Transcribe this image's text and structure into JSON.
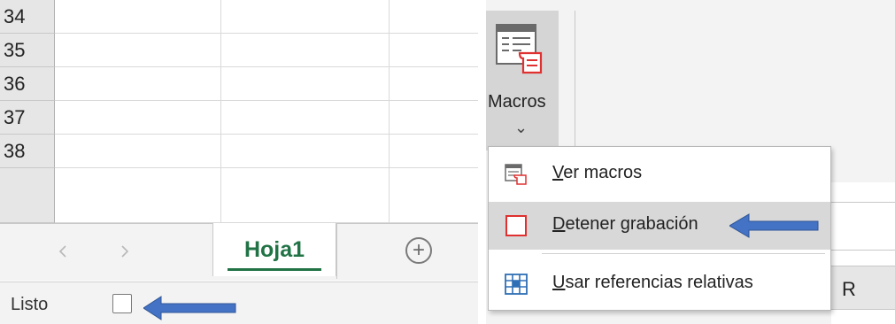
{
  "spreadsheet": {
    "row_numbers": [
      "34",
      "35",
      "36",
      "37",
      "38"
    ],
    "sheet_tab": "Hoja1",
    "add_sheet_symbol": "+",
    "nav_prev_symbol": "◀",
    "nav_next_symbol": "▶"
  },
  "statusbar": {
    "status_text": "Listo",
    "record_icon": "stop-recording-square-icon"
  },
  "ribbon": {
    "macros_label": "Macros",
    "macros_icon": "macros-icon",
    "chevron": "⌄",
    "column_header": "R"
  },
  "dropdown": {
    "items": [
      {
        "label": "Ver macros",
        "icon": "view-macros-icon",
        "mnemonic": "V",
        "rest": "er macros"
      },
      {
        "label": "Detener grabación",
        "icon": "stop-recording-icon",
        "mnemonic": "D",
        "rest": "etener grabación"
      },
      {
        "label": "Usar referencias relativas",
        "icon": "relative-references-icon",
        "mnemonic": "U",
        "rest": "sar referencias relativas"
      }
    ]
  },
  "colors": {
    "arrow": "#4472c4",
    "sheet_tab_text": "#217346",
    "record_red": "#e03030"
  }
}
